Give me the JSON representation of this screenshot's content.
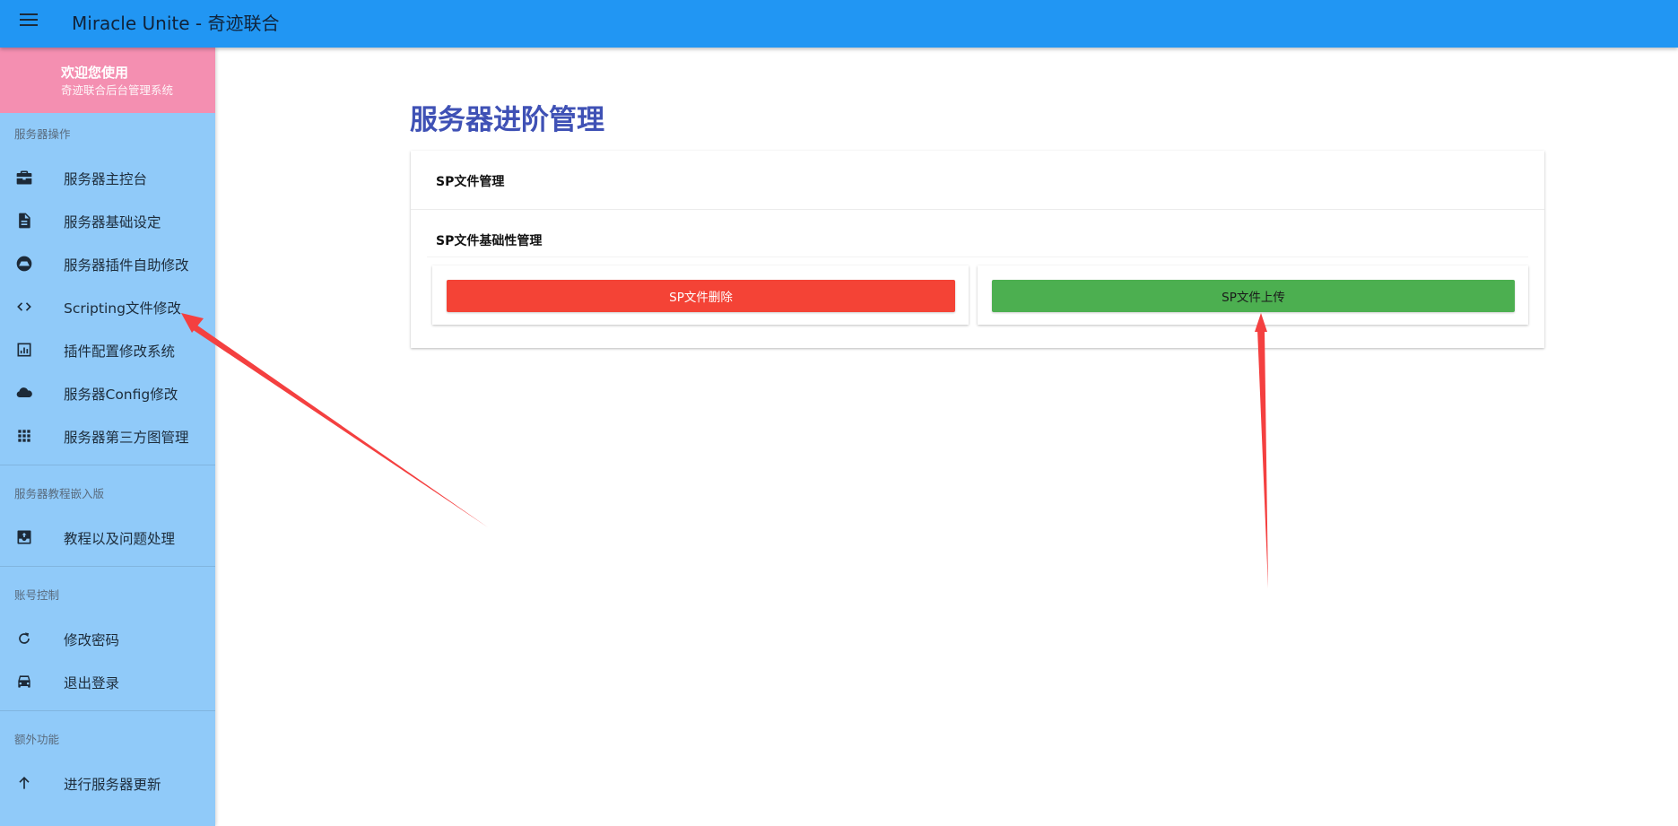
{
  "app": {
    "title": "Miracle Unite - 奇迹联合"
  },
  "drawer": {
    "welcome": "欢迎您使用",
    "welcome_sub": "奇迹联合后台管理系统",
    "sections": [
      {
        "header": "服务器操作",
        "items": [
          {
            "label": "服务器主控台",
            "icon": "briefcase-icon"
          },
          {
            "label": "服务器基础设定",
            "icon": "document-icon"
          },
          {
            "label": "服务器插件自助修改",
            "icon": "drive-icon"
          },
          {
            "label": "Scripting文件修改",
            "icon": "code-icon"
          },
          {
            "label": "插件配置修改系统",
            "icon": "chart-box-icon"
          },
          {
            "label": "服务器Config修改",
            "icon": "cloud-icon"
          },
          {
            "label": "服务器第三方图管理",
            "icon": "apps-grid-icon"
          }
        ]
      },
      {
        "header": "服务器教程嵌入版",
        "items": [
          {
            "label": "教程以及问题处理",
            "icon": "inbox-icon"
          }
        ]
      },
      {
        "header": "账号控制",
        "items": [
          {
            "label": "修改密码",
            "icon": "refresh-icon"
          },
          {
            "label": "退出登录",
            "icon": "car-icon"
          }
        ]
      },
      {
        "header": "额外功能",
        "items": [
          {
            "label": "进行服务器更新",
            "icon": "arrow-up-icon"
          }
        ]
      }
    ]
  },
  "main": {
    "page_title": "服务器进阶管理",
    "card_title": "SP文件管理",
    "section_title": "SP文件基础性管理",
    "delete_button": "SP文件删除",
    "upload_button": "SP文件上传"
  },
  "colors": {
    "appbar": "#2196f3",
    "drawer": "#90caf9",
    "drawer_header": "#f48fb1",
    "page_title": "#3f51b5",
    "delete": "#f44336",
    "upload": "#4caf50",
    "annotation_arrow": "#f44040"
  }
}
